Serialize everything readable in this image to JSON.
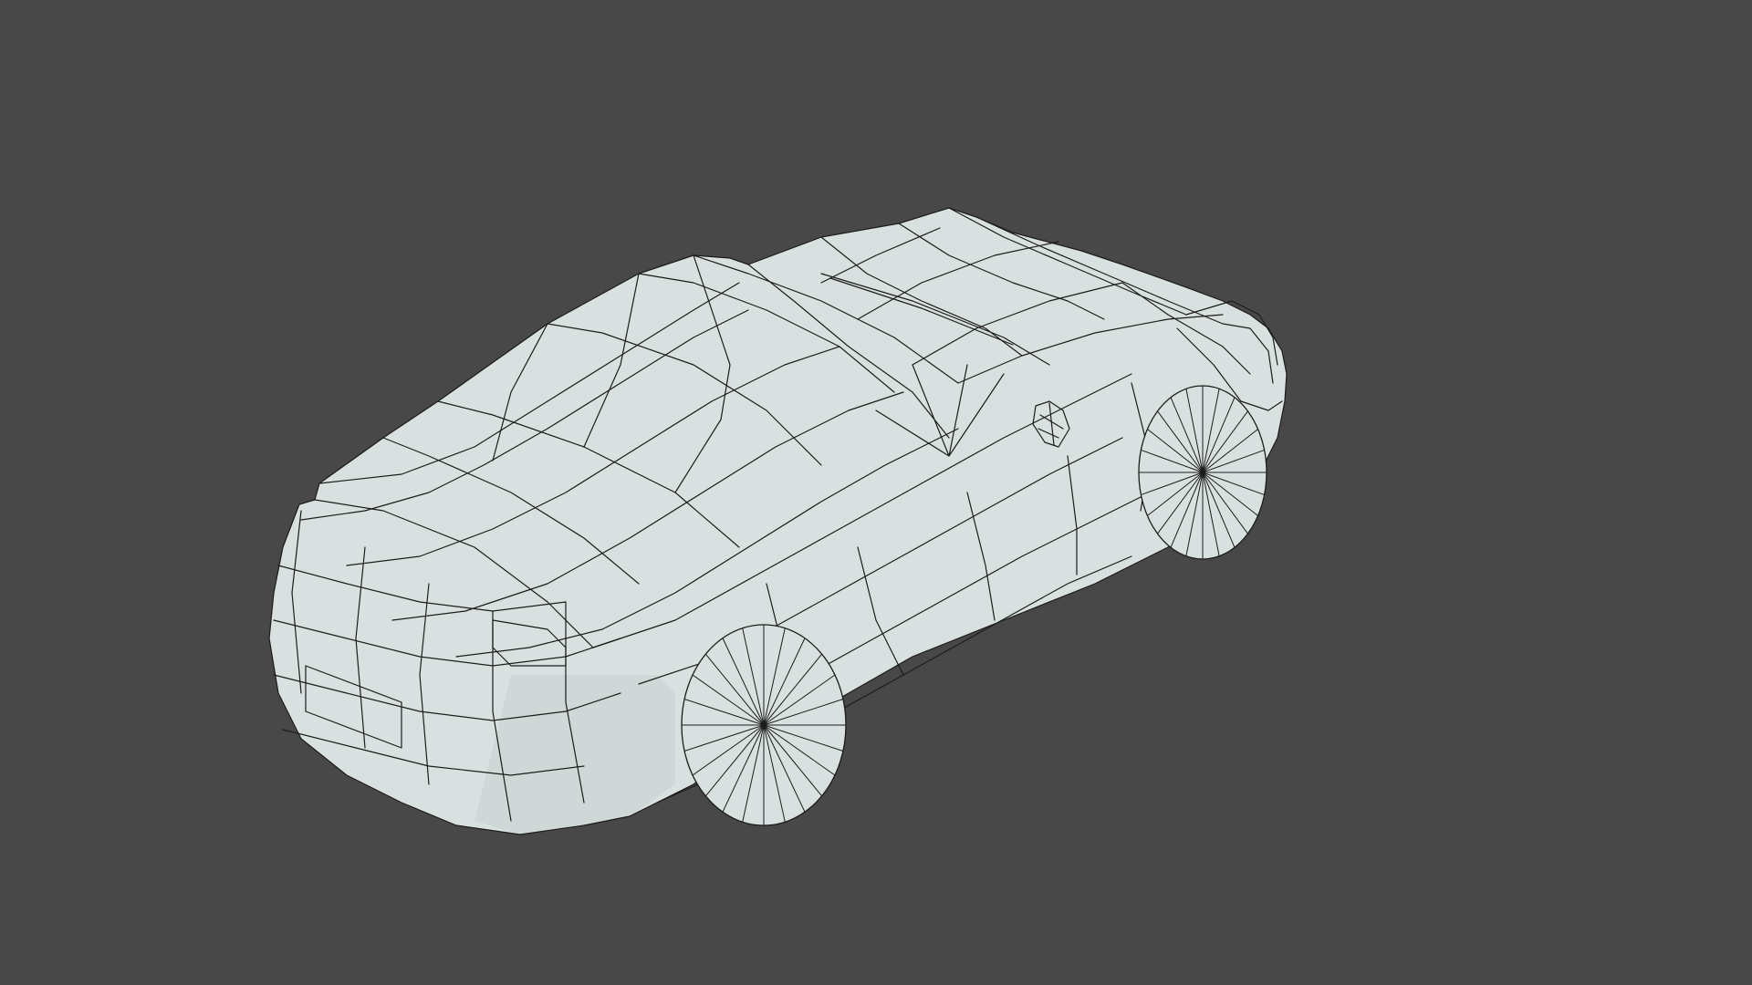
{
  "viewport": {
    "background_color": "#484848"
  },
  "model": {
    "mesh_color": "#d9e0e0",
    "wire_color": "#1c1c1c",
    "wheel_spoke_count": 24
  }
}
